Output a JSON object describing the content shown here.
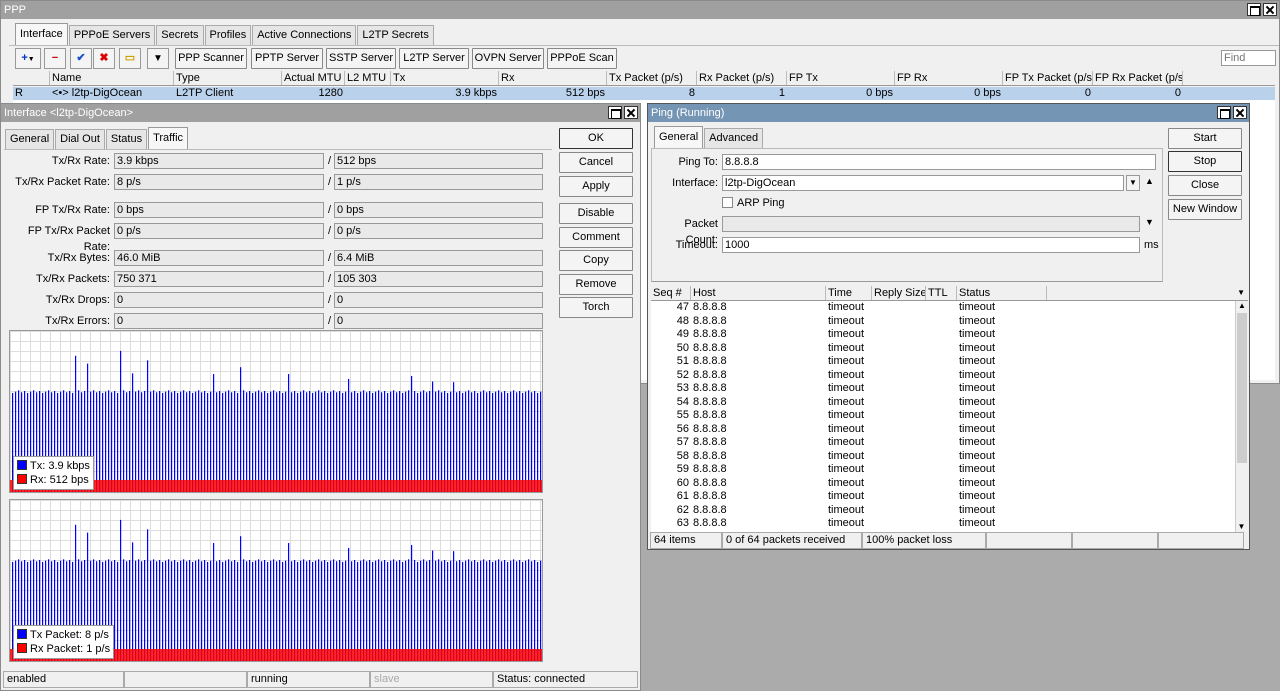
{
  "ppp": {
    "title": "PPP",
    "tabs": [
      "Interface",
      "PPPoE Servers",
      "Secrets",
      "Profiles",
      "Active Connections",
      "L2TP Secrets"
    ],
    "toolbar": {
      "add": "+",
      "remove": "−",
      "enable": "✔",
      "disable": "✖",
      "comment": "▭",
      "filter": "▼"
    },
    "buttons": [
      "PPP Scanner",
      "PPTP Server",
      "SSTP Server",
      "L2TP Server",
      "OVPN Server",
      "PPPoE Scan"
    ],
    "find_placeholder": "Find",
    "columns": [
      "Name",
      "Type",
      "Actual MTU",
      "L2 MTU",
      "Tx",
      "Rx",
      "Tx Packet (p/s)",
      "Rx Packet (p/s)",
      "FP Tx",
      "FP Rx",
      "FP Tx Packet (p/s)",
      "FP Rx Packet (p/s)"
    ],
    "row": {
      "flag": "R",
      "name": "<•> l2tp-DigOcean",
      "type": "L2TP Client",
      "mtu": "1280",
      "l2mtu": "",
      "tx": "3.9 kbps",
      "rx": "512 bps",
      "txp": "8",
      "rxp": "1",
      "fptx": "0 bps",
      "fprx": "0 bps",
      "fptxp": "0",
      "fprxp": "0"
    }
  },
  "iface": {
    "title": "Interface <l2tp-DigOcean>",
    "tabs": [
      "General",
      "Dial Out",
      "Status",
      "Traffic"
    ],
    "fields": [
      {
        "label": "Tx/Rx Rate:",
        "a": "3.9 kbps",
        "b": "512 bps"
      },
      {
        "label": "Tx/Rx Packet Rate:",
        "a": "8 p/s",
        "b": "1 p/s"
      },
      {
        "label": "FP Tx/Rx Rate:",
        "a": "0 bps",
        "b": "0 bps"
      },
      {
        "label": "FP Tx/Rx Packet Rate:",
        "a": "0 p/s",
        "b": "0 p/s"
      },
      {
        "label": "Tx/Rx Bytes:",
        "a": "46.0 MiB",
        "b": "6.4 MiB"
      },
      {
        "label": "Tx/Rx Packets:",
        "a": "750 371",
        "b": "105 303"
      },
      {
        "label": "Tx/Rx Drops:",
        "a": "0",
        "b": "0"
      },
      {
        "label": "Tx/Rx Errors:",
        "a": "0",
        "b": "0"
      }
    ],
    "buttons": [
      "OK",
      "Cancel",
      "Apply",
      "Disable",
      "Comment",
      "Copy",
      "Remove",
      "Torch"
    ],
    "graph1": {
      "tx_label": "Tx:",
      "tx": "3.9 kbps",
      "rx_label": "Rx:",
      "rx": "512 bps"
    },
    "graph2": {
      "tx_label": "Tx Packet:",
      "tx": "8 p/s",
      "rx_label": "Rx Packet:",
      "rx": "1 p/s"
    },
    "colors": {
      "tx": "#0000ff",
      "rx": "#ff0000"
    },
    "status": [
      "enabled",
      "",
      "running",
      "slave",
      "Status: connected"
    ]
  },
  "ping": {
    "title": "Ping (Running)",
    "tabs": [
      "General",
      "Advanced"
    ],
    "ping_to_label": "Ping To:",
    "ping_to": "8.8.8.8",
    "interface_label": "Interface:",
    "interface": "l2tp-DigOcean",
    "arp_ping": "ARP Ping",
    "packet_count_label": "Packet Count:",
    "packet_count": "",
    "timeout_label": "Timeout:",
    "timeout": "1000",
    "timeout_unit": "ms",
    "buttons": [
      "Start",
      "Stop",
      "Close",
      "New Window"
    ],
    "columns": [
      "Seq #",
      "Host",
      "Time",
      "Reply Size",
      "TTL",
      "Status"
    ],
    "rows": [
      {
        "seq": "47",
        "host": "8.8.8.8",
        "time": "timeout",
        "status": "timeout"
      },
      {
        "seq": "48",
        "host": "8.8.8.8",
        "time": "timeout",
        "status": "timeout"
      },
      {
        "seq": "49",
        "host": "8.8.8.8",
        "time": "timeout",
        "status": "timeout"
      },
      {
        "seq": "50",
        "host": "8.8.8.8",
        "time": "timeout",
        "status": "timeout"
      },
      {
        "seq": "51",
        "host": "8.8.8.8",
        "time": "timeout",
        "status": "timeout"
      },
      {
        "seq": "52",
        "host": "8.8.8.8",
        "time": "timeout",
        "status": "timeout"
      },
      {
        "seq": "53",
        "host": "8.8.8.8",
        "time": "timeout",
        "status": "timeout"
      },
      {
        "seq": "54",
        "host": "8.8.8.8",
        "time": "timeout",
        "status": "timeout"
      },
      {
        "seq": "55",
        "host": "8.8.8.8",
        "time": "timeout",
        "status": "timeout"
      },
      {
        "seq": "56",
        "host": "8.8.8.8",
        "time": "timeout",
        "status": "timeout"
      },
      {
        "seq": "57",
        "host": "8.8.8.8",
        "time": "timeout",
        "status": "timeout"
      },
      {
        "seq": "58",
        "host": "8.8.8.8",
        "time": "timeout",
        "status": "timeout"
      },
      {
        "seq": "59",
        "host": "8.8.8.8",
        "time": "timeout",
        "status": "timeout"
      },
      {
        "seq": "60",
        "host": "8.8.8.8",
        "time": "timeout",
        "status": "timeout"
      },
      {
        "seq": "61",
        "host": "8.8.8.8",
        "time": "timeout",
        "status": "timeout"
      },
      {
        "seq": "62",
        "host": "8.8.8.8",
        "time": "timeout",
        "status": "timeout"
      },
      {
        "seq": "63",
        "host": "8.8.8.8",
        "time": "timeout",
        "status": "timeout"
      }
    ],
    "status": [
      "64 items",
      "0 of 64 packets received",
      "100% packet loss"
    ]
  }
}
